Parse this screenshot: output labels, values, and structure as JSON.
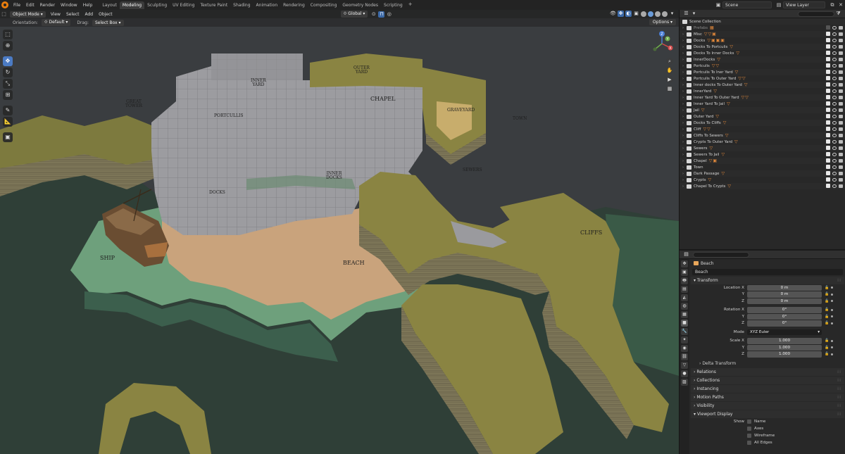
{
  "topbar": {
    "menus": [
      "File",
      "Edit",
      "Render",
      "Window",
      "Help"
    ],
    "workspaces": [
      "Layout",
      "Modeling",
      "Sculpting",
      "UV Editing",
      "Texture Paint",
      "Shading",
      "Animation",
      "Rendering",
      "Compositing",
      "Geometry Nodes",
      "Scripting"
    ],
    "active_workspace": "Modeling",
    "add_tab": "+",
    "scene": "Scene",
    "view_layer": "View Layer"
  },
  "viewport": {
    "mode": "Object Mode",
    "menus": [
      "View",
      "Select",
      "Add",
      "Object"
    ],
    "transform_space": "Global",
    "orientation_label": "Orientation:",
    "orientation_value": "Default",
    "drag_label": "Drag:",
    "drag_value": "Select Box",
    "options": "Options",
    "gizmo": {
      "z": "Z",
      "y": "Y",
      "x": "X"
    },
    "labels": {
      "great_tower": "GREAT\nTOWER",
      "inner_yard": "INNER\nYARD",
      "outer_yard": "OUTER\nYARD",
      "chapel": "CHAPEL",
      "graveyard": "GRAVEYARD",
      "town": "TOWN",
      "portcullis": "PORTCULLIS",
      "inner_docks": "INNER\nDOCKS",
      "sewers": "SEWERS",
      "docks": "DOCKS",
      "cliffs": "CLIFFS",
      "ship": "SHIP",
      "beach": "BEACH"
    },
    "colors": {
      "water": "#2e3d36",
      "water_light": "#34453c",
      "grass": "#7a7a3c",
      "cliff_side": "#6f6a50",
      "shore": "#6aa07a",
      "sand": "#c8a27a",
      "castle": "#9a9a9e",
      "void": "#3a3d40"
    }
  },
  "outliner": {
    "root": "Scene Collection",
    "search_placeholder": "",
    "items": [
      {
        "name": "Prefabs",
        "dim": true,
        "tags": "▦"
      },
      {
        "name": "Misc",
        "tags": "▽▽▣"
      },
      {
        "name": "Docks",
        "tags": "▽▣▣▣"
      },
      {
        "name": "Docks To Portculis",
        "tags": "▽"
      },
      {
        "name": "Docks To Inner Docks",
        "tags": "▽"
      },
      {
        "name": "InnerDocks",
        "tags": "▽"
      },
      {
        "name": "Portculis",
        "tags": "▽▽"
      },
      {
        "name": "Portculis To Iner Yard",
        "tags": "▽"
      },
      {
        "name": "Portculis To Outer Yard",
        "tags": "▽▽"
      },
      {
        "name": "Inner docks To Outer Yard",
        "tags": "▽"
      },
      {
        "name": "InnerYard",
        "tags": "▽"
      },
      {
        "name": "Inner Yard To Outer Yard",
        "tags": "▽▽"
      },
      {
        "name": "Inner Yard To Jail",
        "tags": "▽"
      },
      {
        "name": "Jail",
        "tags": "▽"
      },
      {
        "name": "Outer Yard",
        "tags": "▽"
      },
      {
        "name": "Docks To Cliffs",
        "tags": "▽"
      },
      {
        "name": "Cliff",
        "tags": "▽▽"
      },
      {
        "name": "Cliffs To Sewers",
        "tags": "▽"
      },
      {
        "name": "Crypts To Outer Yard",
        "tags": "▽"
      },
      {
        "name": "Sewers",
        "tags": "▽"
      },
      {
        "name": "Sewers To Jail",
        "tags": "▽"
      },
      {
        "name": "Chapel",
        "tags": "▽▣"
      },
      {
        "name": "Town",
        "tags": ""
      },
      {
        "name": "Dark Passage",
        "tags": "▽"
      },
      {
        "name": "Crypts",
        "tags": "▽"
      },
      {
        "name": "Chapel To Crypts",
        "tags": "▽"
      }
    ]
  },
  "properties": {
    "object": "Beach",
    "name_field": "Beach",
    "transform": "Transform",
    "location": {
      "label_x": "Location X",
      "x": "0 m",
      "y": "0 m",
      "z": "0 m"
    },
    "rotation": {
      "label_x": "Rotation X",
      "x": "0°",
      "y": "0°",
      "z": "0°"
    },
    "mode_label": "Mode",
    "mode_value": "XYZ Euler",
    "scale": {
      "label_x": "Scale X",
      "x": "1.000",
      "y": "1.000",
      "z": "1.000"
    },
    "axis_y": "Y",
    "axis_z": "Z",
    "delta_transform": "Delta Transform",
    "sections": [
      "Relations",
      "Collections",
      "Instancing",
      "Motion Paths",
      "Visibility"
    ],
    "viewport_display": "Viewport Display",
    "show_label": "Show",
    "show_options": [
      "Name",
      "Axes",
      "Wireframe",
      "All Edges"
    ]
  }
}
